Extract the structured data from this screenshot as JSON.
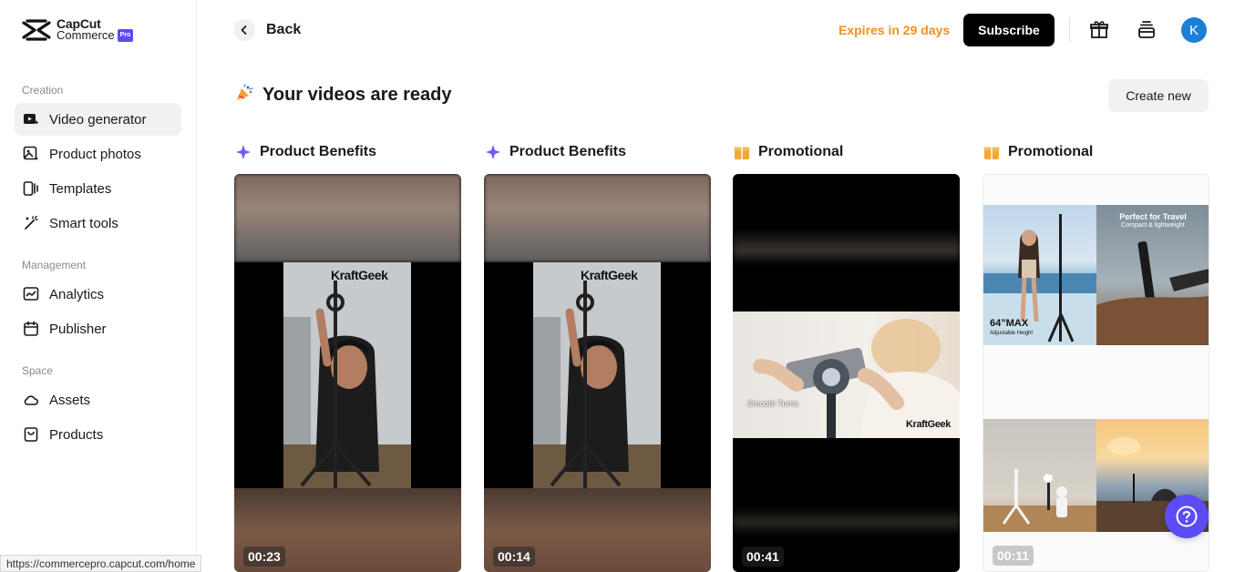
{
  "logo": {
    "line1": "CapCut",
    "line2": "Commerce",
    "badge": "Pro"
  },
  "sidebar": {
    "sections": [
      {
        "label": "Creation"
      },
      {
        "label": "Management"
      },
      {
        "label": "Space"
      }
    ],
    "items": [
      {
        "label": "Video generator",
        "icon": "video-generator-icon",
        "active": true
      },
      {
        "label": "Product photos",
        "icon": "product-photos-icon"
      },
      {
        "label": "Templates",
        "icon": "templates-icon"
      },
      {
        "label": "Smart tools",
        "icon": "magic-wand-icon"
      },
      {
        "label": "Analytics",
        "icon": "analytics-icon"
      },
      {
        "label": "Publisher",
        "icon": "calendar-icon"
      },
      {
        "label": "Assets",
        "icon": "cloud-icon"
      },
      {
        "label": "Products",
        "icon": "bag-icon"
      }
    ]
  },
  "header": {
    "back_label": "Back",
    "expires": "Expires in 29 days",
    "subscribe": "Subscribe",
    "avatar_letter": "K"
  },
  "page": {
    "title": "Your videos are ready",
    "create_new": "Create new"
  },
  "videos": [
    {
      "category": "Product Benefits",
      "duration": "00:23",
      "watermark": "KraftGeek"
    },
    {
      "category": "Product Benefits",
      "duration": "00:14",
      "watermark": "KraftGeek"
    },
    {
      "category": "Promotional",
      "duration": "00:41",
      "caption": "Smooth Turns",
      "watermark": "KraftGeek"
    },
    {
      "category": "Promotional",
      "duration": "00:11",
      "panel1": "64”MAX",
      "panel1_sub": "Adjustable Height",
      "panel2": "Perfect for Travel",
      "panel2_sub": "Compact & lightweight"
    }
  ],
  "status_url": "https://commercepro.capcut.com/home",
  "colors": {
    "accent": "#5b4cf5",
    "warning": "#f0901d",
    "avatar": "#1d7ed6"
  }
}
